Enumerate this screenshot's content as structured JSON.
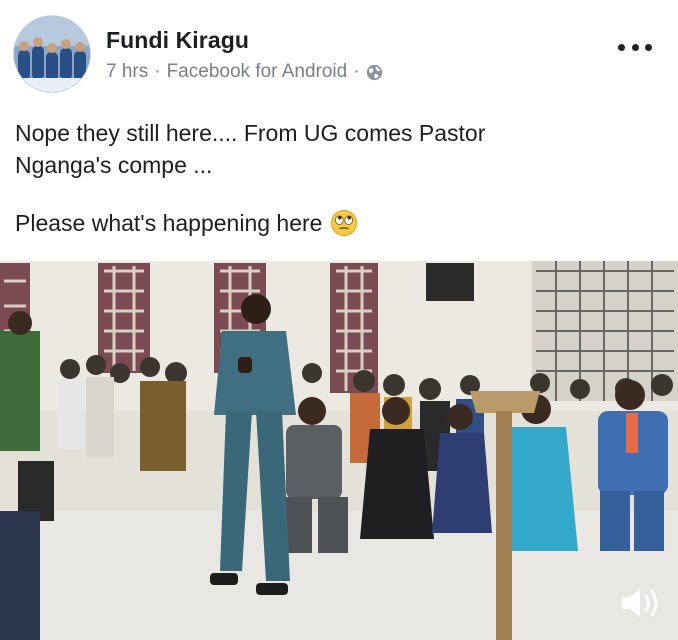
{
  "post": {
    "author": "Fundi Kiragu",
    "time": "7 hrs",
    "separator": "·",
    "source": "Facebook for Android",
    "text_line1": "Nope they still here.... From UG comes Pastor",
    "text_line2": "Nganga's compe ...",
    "caption": "Please what's happening here"
  },
  "icons": {
    "more": "more-options-icon",
    "privacy": "globe-icon",
    "emoji": "rolling-eyes-emoji",
    "volume": "volume-icon"
  },
  "colors": {
    "text": "#1c1e21",
    "meta": "#7a7f87",
    "suit": "#3f6f80",
    "blue_dress": "#35a9c9"
  }
}
